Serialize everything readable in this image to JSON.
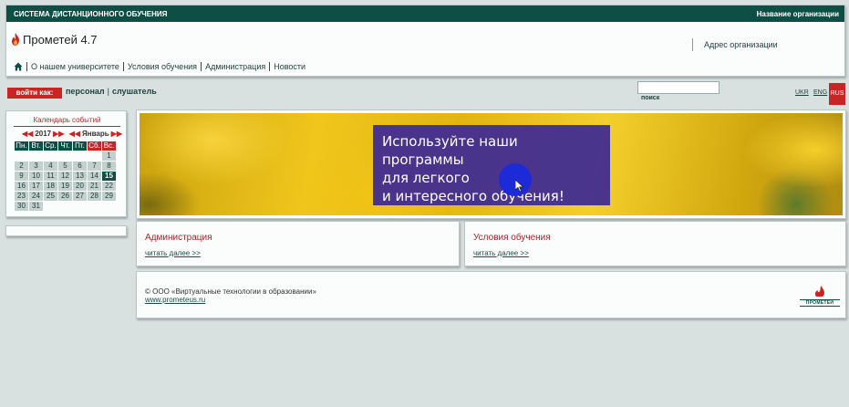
{
  "topbar": {
    "system_title": "СИСТЕМА ДИСТАНЦИОННОГО ОБУЧЕНИЯ",
    "org_name": "Название организации"
  },
  "logo": {
    "text": "Прометей 4.7"
  },
  "org_address": "Адрес организации",
  "nav": {
    "items": [
      "О нашем университете",
      "Условия обучения",
      "Администрация",
      "Новости"
    ]
  },
  "login": {
    "label": "войти как:",
    "staff": "персонал",
    "listener": "слушатель"
  },
  "search": {
    "label": "поиск",
    "value": ""
  },
  "languages": {
    "ukr": "UKR",
    "eng": "ENG",
    "rus": "RUS"
  },
  "calendar": {
    "title": "Календарь событий",
    "year": "2017",
    "month": "Январь",
    "weekdays": [
      "Пн.",
      "Вт.",
      "Ср.",
      "Чт.",
      "Пт.",
      "Сб.",
      "Вс."
    ],
    "weeks": [
      [
        "",
        "",
        "",
        "",
        "",
        "",
        "1"
      ],
      [
        "2",
        "3",
        "4",
        "5",
        "6",
        "7",
        "8"
      ],
      [
        "9",
        "10",
        "11",
        "12",
        "13",
        "14",
        "15"
      ],
      [
        "16",
        "17",
        "18",
        "19",
        "20",
        "21",
        "22"
      ],
      [
        "23",
        "24",
        "25",
        "26",
        "27",
        "28",
        "29"
      ],
      [
        "30",
        "31",
        "",
        "",
        "",
        "",
        ""
      ]
    ],
    "today": "15",
    "colors": {
      "header": "#0e4f45",
      "weekend": "#c82525",
      "day": "#c3d0ce"
    }
  },
  "banner": {
    "line1": "Используйте наши программы",
    "line2": "для легкого",
    "line3": "и интересного обучения!"
  },
  "articles": [
    {
      "title": "Администрация",
      "more": "читать далее >>"
    },
    {
      "title": "Условия обучения",
      "more": "читать далее >>"
    }
  ],
  "footer": {
    "copyright": "© ООО «Виртуальные технологии в образовании»",
    "site": "www.prometeus.ru",
    "logo_text": "ПРОМЕТЕЙ"
  },
  "colors": {
    "brand_dark": "#0e4f45",
    "accent_red": "#c82525",
    "background": "#d9e1e0"
  }
}
